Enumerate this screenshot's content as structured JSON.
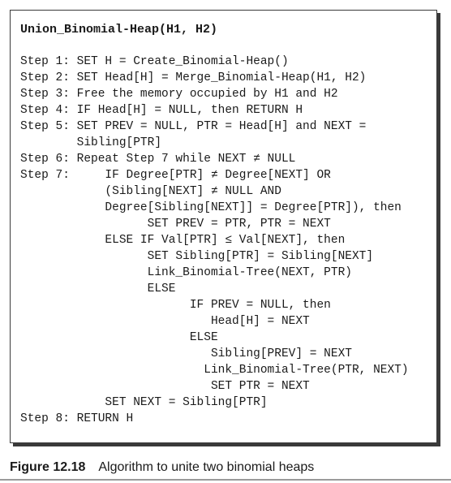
{
  "algorithm": {
    "title": "Union_Binomial-Heap(H1, H2)",
    "lines": [
      "Step 1: SET H = Create_Binomial-Heap()",
      "Step 2: SET Head[H] = Merge_Binomial-Heap(H1, H2)",
      "Step 3: Free the memory occupied by H1 and H2",
      "Step 4: IF Head[H] = NULL, then RETURN H",
      "Step 5: SET PREV = NULL, PTR = Head[H] and NEXT =",
      "        Sibling[PTR]",
      "Step 6: Repeat Step 7 while NEXT ≠ NULL",
      "Step 7:     IF Degree[PTR] ≠ Degree[NEXT] OR",
      "            (Sibling[NEXT] ≠ NULL AND",
      "            Degree[Sibling[NEXT]] = Degree[PTR]), then",
      "                  SET PREV = PTR, PTR = NEXT",
      "            ELSE IF Val[PTR] ≤ Val[NEXT], then",
      "                  SET Sibling[PTR] = Sibling[NEXT]",
      "                  Link_Binomial-Tree(NEXT, PTR)",
      "                  ELSE",
      "                        IF PREV = NULL, then",
      "                           Head[H] = NEXT",
      "                        ELSE",
      "                           Sibling[PREV] = NEXT",
      "                          Link_Binomial-Tree(PTR, NEXT)",
      "                           SET PTR = NEXT",
      "            SET NEXT = Sibling[PTR]",
      "Step 8: RETURN H"
    ]
  },
  "caption": {
    "label": "Figure 12.18",
    "text": "Algorithm to unite two binomial heaps"
  }
}
